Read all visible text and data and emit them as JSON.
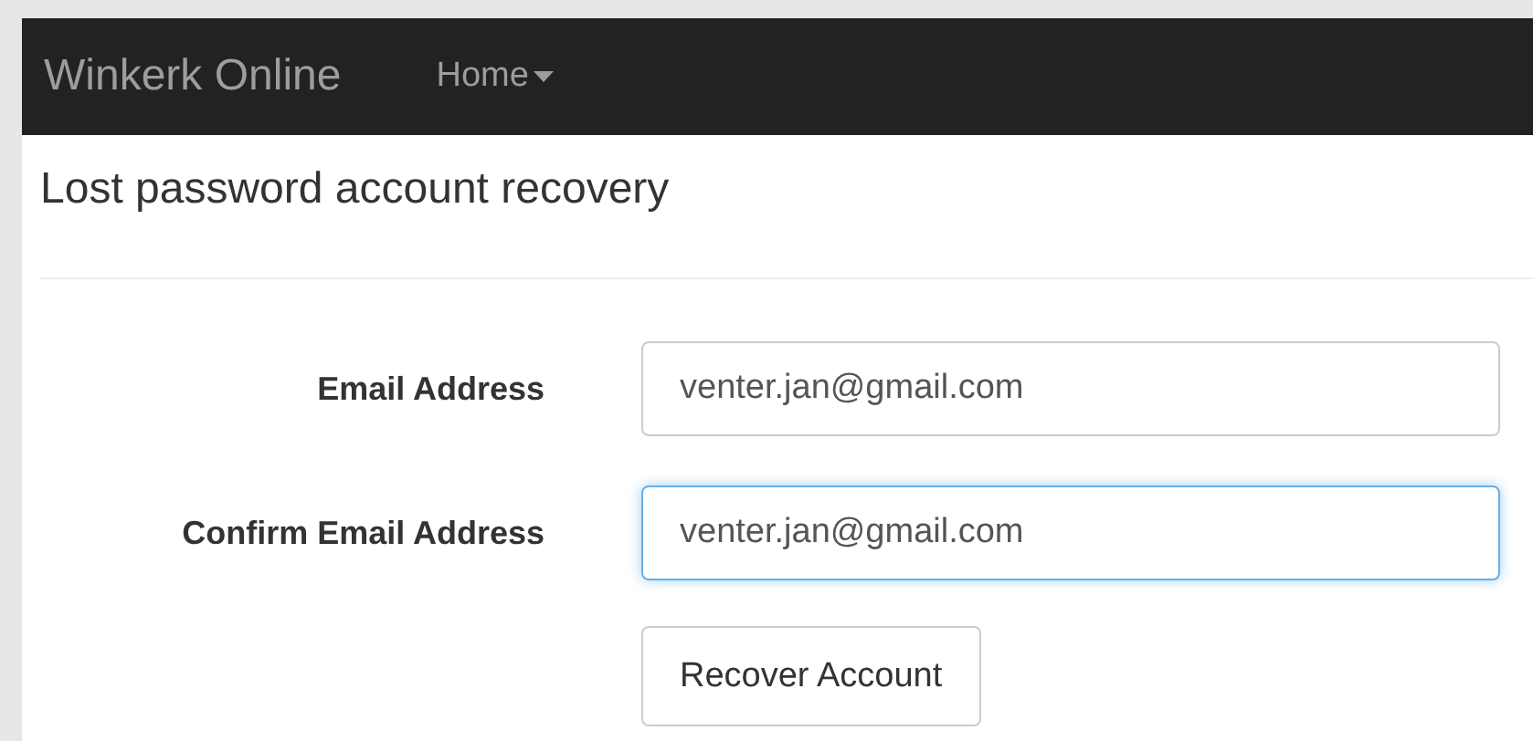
{
  "navbar": {
    "brand": "Winkerk Online",
    "menu": [
      {
        "label": "Home",
        "dropdown": true
      }
    ]
  },
  "heading": "Lost password account recovery",
  "form": {
    "fields": [
      {
        "label": "Email Address",
        "value": "venter.jan@gmail.com",
        "focused": false
      },
      {
        "label": "Confirm Email Address",
        "value": "venter.jan@gmail.com",
        "focused": true
      }
    ],
    "submit": "Recover Account"
  }
}
